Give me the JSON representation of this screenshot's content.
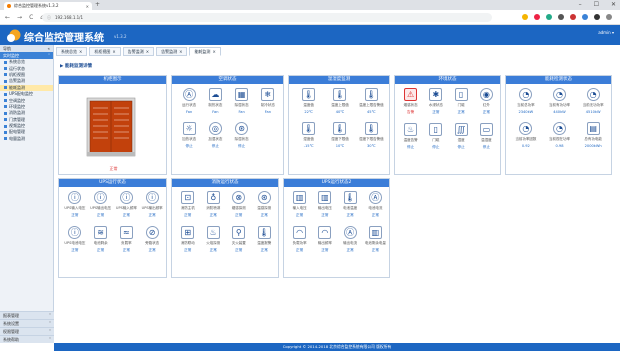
{
  "browser": {
    "tab_title": "综合监控管理系统v1.3.2",
    "url": "192.168.1.1/1",
    "new_tab": "+",
    "nav": [
      "←",
      "→",
      "C",
      "⌂"
    ]
  },
  "app": {
    "title": "综合监控管理系统",
    "version": "v1.3.2",
    "user": "admin ▾",
    "footer": "Copyright © 2014-2018 北京综合监控系统有限公司 版权所有"
  },
  "sidebar": {
    "header": "导航",
    "section": "实时监控",
    "items": [
      {
        "label": "系统总览",
        "active": false
      },
      {
        "label": "运行状态",
        "active": false
      },
      {
        "label": "机柜视图",
        "active": false
      },
      {
        "label": "告警监测",
        "active": false
      },
      {
        "label": "能耗监测",
        "active": true
      },
      {
        "label": "UPS配电监控",
        "active": false
      },
      {
        "label": "空调监控",
        "active": false
      },
      {
        "label": "环境监控",
        "active": false
      },
      {
        "label": "消防监测",
        "active": false
      },
      {
        "label": "门禁管理",
        "active": false
      },
      {
        "label": "视频监控",
        "active": false
      },
      {
        "label": "配电管理",
        "active": false
      },
      {
        "label": "电量监测",
        "active": false
      }
    ],
    "bottom": [
      "报表管理",
      "系统设置",
      "权限管理",
      "系统帮助"
    ]
  },
  "tabs": [
    {
      "label": "系统总览",
      "active": false
    },
    {
      "label": "机柜视图",
      "active": false
    },
    {
      "label": "告警监测",
      "active": false
    },
    {
      "label": "告警监测",
      "active": false
    },
    {
      "label": "能耗监测",
      "active": true
    }
  ],
  "breadcrumb": "▶ 能耗监测详情",
  "panels": {
    "cabinet": {
      "title": "机柜图示",
      "status": "正常"
    },
    "aircon": {
      "title": "空调状态",
      "items": [
        {
          "icon": "Ⓐ",
          "label": "运行状态",
          "value": "Fan"
        },
        {
          "icon": "☁",
          "label": "制热状态",
          "value": "Fan"
        },
        {
          "icon": "▦",
          "label": "除湿状态",
          "value": "Fan"
        },
        {
          "icon": "❄",
          "label": "制冷状态",
          "value": "Fan"
        },
        {
          "icon": "☼",
          "label": "加热状态",
          "value": "停止"
        },
        {
          "icon": "◎",
          "label": "加湿状态",
          "value": "停止"
        },
        {
          "icon": "⊛",
          "label": "除湿状态",
          "value": "停止"
        }
      ]
    },
    "temp": {
      "title": "温湿度监测",
      "items": [
        {
          "icon": "🌡",
          "label": "温度值",
          "value": "22℃"
        },
        {
          "icon": "🌡",
          "label": "温度上限值",
          "value": "40℃"
        },
        {
          "icon": "🌡",
          "label": "温度上限告警值",
          "value": "45℃"
        },
        {
          "icon": "🌡",
          "label": "湿度值",
          "value": "-15℃"
        },
        {
          "icon": "🌡",
          "label": "湿度下限值",
          "value": "10℃"
        },
        {
          "icon": "🌡",
          "label": "湿度下限告警值",
          "value": "30℃"
        }
      ]
    },
    "env": {
      "title": "环境状态",
      "items": [
        {
          "icon": "⚠",
          "label": "烟感状态",
          "value": "告警",
          "alert": true
        },
        {
          "icon": "✱",
          "label": "水浸状态",
          "value": "正常"
        },
        {
          "icon": "▯",
          "label": "门磁",
          "value": "正常"
        },
        {
          "icon": "◉",
          "label": "红外",
          "value": "正常"
        },
        {
          "icon": "♨",
          "label": "温度告警",
          "value": "停止"
        },
        {
          "icon": "▯",
          "label": "门磁",
          "value": "停止"
        },
        {
          "icon": "∭",
          "label": "湿度",
          "value": "停止"
        },
        {
          "icon": "▭",
          "label": "温湿度",
          "value": "停止"
        }
      ]
    },
    "power": {
      "title": "能耗检测状态",
      "items": [
        {
          "icon": "◔",
          "label": "当前总功率",
          "value": "2340kW"
        },
        {
          "icon": "◔",
          "label": "当前有功功率",
          "value": "440kW"
        },
        {
          "icon": "◔",
          "label": "当前无功功率",
          "value": "4510kW"
        },
        {
          "icon": "◔",
          "label": "当前功率因数",
          "value": "0.92"
        },
        {
          "icon": "◔",
          "label": "当前视在功率",
          "value": "0.98"
        },
        {
          "icon": "▤",
          "label": "总有功电能",
          "value": "2000kWh"
        }
      ]
    },
    "ups1": {
      "title": "UPS运行状态",
      "items": [
        {
          "icon": "ⓘ",
          "label": "UPS输入电压",
          "value": "正常"
        },
        {
          "icon": "ⓘ",
          "label": "UPS输出电压",
          "value": "正常"
        },
        {
          "icon": "ⓘ",
          "label": "UPS输入频率",
          "value": "正常"
        },
        {
          "icon": "ⓘ",
          "label": "UPS输出频率",
          "value": "正常"
        },
        {
          "icon": "ⓘ",
          "label": "UPS电池电压",
          "value": "正常"
        },
        {
          "icon": "≋",
          "label": "电池剩余",
          "value": "正常"
        },
        {
          "icon": "≈",
          "label": "负载率",
          "value": "正常"
        },
        {
          "icon": "⊘",
          "label": "旁路状态",
          "value": "正常"
        }
      ]
    },
    "fire": {
      "title": "消防运行状态",
      "items": [
        {
          "icon": "⊡",
          "label": "消防主机",
          "value": "正常"
        },
        {
          "icon": "♁",
          "label": "消防喷淋",
          "value": "正常"
        },
        {
          "icon": "⊗",
          "label": "烟感探测",
          "value": "正常"
        },
        {
          "icon": "⊛",
          "label": "温感探测",
          "value": "正常"
        },
        {
          "icon": "⊞",
          "label": "消防联动",
          "value": "正常"
        },
        {
          "icon": "♨",
          "label": "火焰探测",
          "value": "正常"
        },
        {
          "icon": "⚲",
          "label": "灭火装置",
          "value": "正常"
        },
        {
          "icon": "🌡",
          "label": "温度报警",
          "value": "正常"
        }
      ]
    },
    "ups2": {
      "title": "UPS运行状态2",
      "items": [
        {
          "icon": "▥",
          "label": "输入电压",
          "value": "正常"
        },
        {
          "icon": "▥",
          "label": "输出电压",
          "value": "正常"
        },
        {
          "icon": "🌡",
          "label": "电池温度",
          "value": "正常"
        },
        {
          "icon": "Ⓐ",
          "label": "电池电流",
          "value": "正常"
        },
        {
          "icon": "◠",
          "label": "负载功率",
          "value": "正常"
        },
        {
          "icon": "◠",
          "label": "输出频率",
          "value": "正常"
        },
        {
          "icon": "Ⓐ",
          "label": "输出电流",
          "value": "正常"
        },
        {
          "icon": "▥",
          "label": "电池剩余电量",
          "value": "正常"
        }
      ]
    }
  },
  "colors": {
    "header_blue": "#1c66c2",
    "panel_head": "#3b7dd8",
    "alert_red": "#d33"
  }
}
